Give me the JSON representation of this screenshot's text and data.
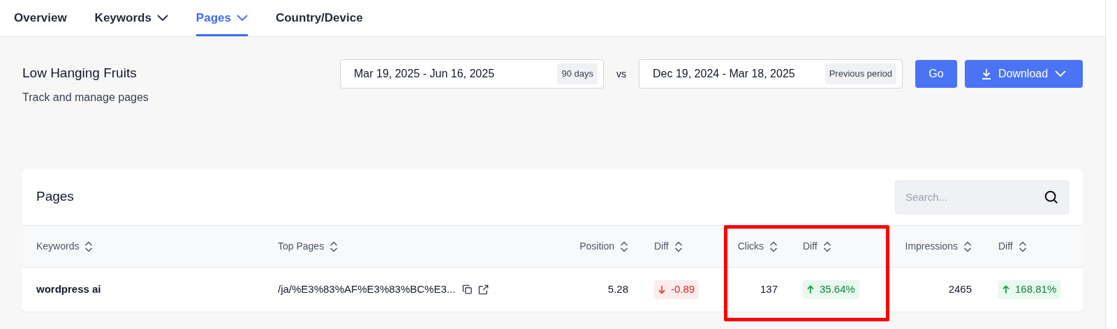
{
  "tabs": [
    {
      "label": "Overview",
      "selected": false,
      "dropdown": false
    },
    {
      "label": "Keywords",
      "selected": false,
      "dropdown": true
    },
    {
      "label": "Pages",
      "selected": true,
      "dropdown": true
    },
    {
      "label": "Country/Device",
      "selected": false,
      "dropdown": false
    }
  ],
  "header": {
    "title": "Low Hanging Fruits",
    "subtitle": "Track and manage pages"
  },
  "date_range": {
    "value": "Mar 19, 2025 - Jun 16, 2025",
    "badge": "90 days"
  },
  "vs_label": "vs",
  "compare_range": {
    "value": "Dec 19, 2024 - Mar 18, 2025",
    "badge": "Previous period"
  },
  "buttons": [
    {
      "kind": "go",
      "label": "Go"
    },
    {
      "kind": "download",
      "label": "Download"
    }
  ],
  "table": {
    "title": "Pages",
    "search": {
      "placeholder": "Search..."
    },
    "columns": [
      {
        "label": "Keywords",
        "highlighted": false
      },
      {
        "label": "Top Pages",
        "highlighted": false
      },
      {
        "label": "Position",
        "highlighted": false
      },
      {
        "label": "Diff",
        "highlighted": false
      },
      {
        "label": "Clicks",
        "highlighted": true
      },
      {
        "label": "Diff",
        "highlighted": true
      },
      {
        "label": "Impressions",
        "highlighted": false
      },
      {
        "label": "Diff",
        "highlighted": false
      }
    ],
    "rows": [
      {
        "cells": [
          {
            "kind": "text",
            "value": "wordpress ai"
          },
          {
            "kind": "url",
            "value": "/ja/%E3%83%AF%E3%83%BC%E3..."
          },
          {
            "kind": "number",
            "value": "5.28"
          },
          {
            "kind": "diff",
            "value": "-0.89",
            "positive": false
          },
          {
            "kind": "number",
            "value": "137"
          },
          {
            "kind": "diff",
            "value": "35.64%",
            "positive": true
          },
          {
            "kind": "number",
            "value": "2465"
          },
          {
            "kind": "diff",
            "value": "168.81%",
            "positive": true
          }
        ]
      }
    ]
  }
}
